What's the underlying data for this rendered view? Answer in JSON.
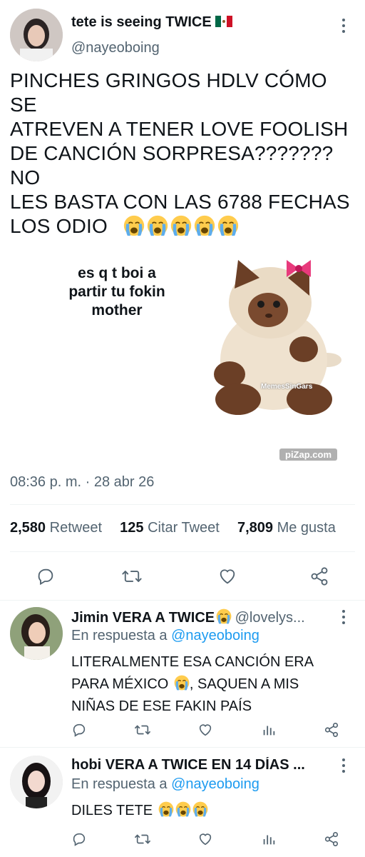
{
  "tweet": {
    "display_name": "tete is seeing TWICE",
    "flag": "🇲🇽",
    "handle": "@nayeoboing",
    "text_line1": "PINCHES GRINGOS HDLV CÓMO SE",
    "text_line2": "ATREVEN A TENER LOVE FOOLISH",
    "text_line3": "DE CANCIÓN SORPRESA??????? NO",
    "text_line4": "LES BASTA CON LAS 6788 FECHAS",
    "text_line5": "LOS ODIO",
    "meme_line1": "es q t boi a",
    "meme_line2": "partir tu fokin",
    "meme_line3": "mother",
    "meme_watermark": "MemesSinGars",
    "pizap_label": "piZap.com",
    "time": "08:36 p. m.",
    "date_sep": "·",
    "date": "28 abr 26",
    "retweets_count": "2,580",
    "retweets_label": "Retweet",
    "quotes_count": "125",
    "quotes_label": "Citar Tweet",
    "likes_count": "7,809",
    "likes_label": "Me gusta"
  },
  "replies": [
    {
      "display_name": "Jimin VERA A TWICE",
      "handle": "@lovelys...",
      "reply_prefix": "En respuesta a",
      "reply_to": "@nayeoboing",
      "line1": "LITERALMENTE ESA CANCIÓN ERA",
      "line2": "PARA MÉXICO",
      "line2b": ", SAQUEN A MIS",
      "line3": "NIÑAS DE ESE FAKIN PAÍS"
    },
    {
      "display_name": "hobi VERA A TWICE EN 14 DÍAS ...",
      "reply_prefix": "En respuesta a",
      "reply_to": "@nayeoboing",
      "line1": "DILES TETE"
    }
  ],
  "colors": {
    "link": "#1d9bf0",
    "muted": "#536471",
    "text": "#0f1419",
    "divider": "#eff3f4"
  },
  "icons": [
    "more-icon",
    "reply-icon",
    "retweet-icon",
    "like-icon",
    "share-icon",
    "analytics-icon",
    "crying-emoji-icon"
  ]
}
